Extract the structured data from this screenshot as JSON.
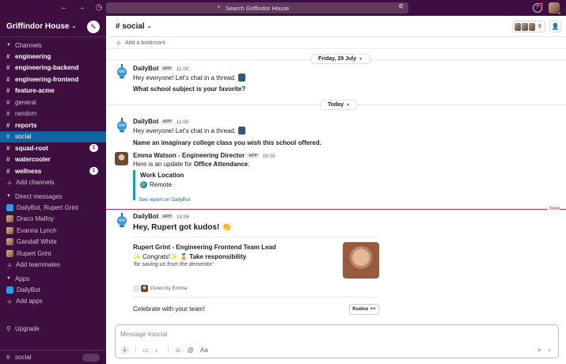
{
  "search": {
    "placeholder": "Search Griffindor House"
  },
  "workspace": {
    "name": "Griffindor House"
  },
  "sidebar": {
    "channels_title": "Channels",
    "channels": [
      {
        "name": "engineering",
        "bold": true
      },
      {
        "name": "engineering-backend",
        "bold": true
      },
      {
        "name": "engineering-frontend",
        "bold": true
      },
      {
        "name": "feature-acme",
        "bold": true
      },
      {
        "name": "general",
        "bold": false
      },
      {
        "name": "random",
        "bold": false
      },
      {
        "name": "reports",
        "bold": true
      },
      {
        "name": "social",
        "active": true
      },
      {
        "name": "squad-root",
        "bold": true,
        "badge": "1"
      },
      {
        "name": "watercooler",
        "bold": true
      },
      {
        "name": "wellness",
        "bold": true,
        "badge": "1"
      }
    ],
    "add_channels": "Add channels",
    "dm_title": "Direct messages",
    "dms": [
      "DailyBot, Rupert Grint",
      "Draco Malfoy",
      "Evanna Lynch",
      "Gandalf White",
      "Rupert Grint"
    ],
    "add_teammates": "Add teammates",
    "apps_title": "Apps",
    "apps": [
      "DailyBot"
    ],
    "add_apps": "Add apps",
    "upgrade": "Upgrade",
    "footer_channel": "social"
  },
  "header": {
    "channel": "social",
    "member_count": "8",
    "bookmark": "Add a bookmark"
  },
  "dates": {
    "first": "Friday, 29 July",
    "second": "Today"
  },
  "messages": {
    "m1": {
      "name": "DailyBot",
      "tag": "APP",
      "time": "11:00",
      "line1": "Hey everyone! Let's chat in a thread.",
      "line2": "What school subject is your favorite?"
    },
    "m2": {
      "name": "DailyBot",
      "tag": "APP",
      "time": "11:00",
      "line1": "Hey everyone! Let's chat in a thread.",
      "line2": "Name an imaginary college class you wish this school offered."
    },
    "m3": {
      "name": "Emma Watson - Engineering Director",
      "tag": "APP",
      "time": "18:03",
      "intro": "Here is an update for ",
      "intro_bold": "Office Attendance",
      "intro_end": ":",
      "quote_title": "Work Location",
      "quote_value": "Remote",
      "link": "See report on DailyBot"
    },
    "m4": {
      "name": "DailyBot",
      "tag": "APP",
      "time": "18:06",
      "headline": "Hey, Rupert got kudos! 👏",
      "card_title": "Rupert Grint - Engineering Frontend Team Lead",
      "congrats": "✨ Congrats!✨ 🏅 ",
      "congrats_bold": "Take responsibility",
      "reason": "'for saving us from the dementor'",
      "given": "Given by Emma",
      "celebrate": "Celebrate with your team!",
      "button": "Kudos ++"
    }
  },
  "new_label": "New",
  "composer": {
    "placeholder": "Message #social"
  }
}
